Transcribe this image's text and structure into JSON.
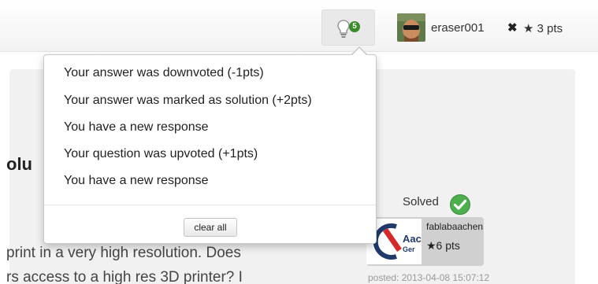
{
  "navbar": {
    "notification_count": "5",
    "username": "eraser001",
    "logout_symbol": "✖",
    "points": "★ 3 pts"
  },
  "notifications": {
    "items": [
      "Your answer was downvoted (-1pts)",
      "Your answer was marked as solution (+2pts)",
      "You have a new response",
      "Your question was upvoted (+1pts)",
      "You have a new response"
    ],
    "clear_label": "clear all"
  },
  "question": {
    "title_fragment": "olu",
    "body_line1": "print in a very high resolution. Does",
    "body_line2": "rs access to a high res 3D printer? I"
  },
  "answer": {
    "solved_label": "Solved",
    "org_logo_text1": "Aac",
    "org_logo_text2": "Ger",
    "answerer": "fablabaachen",
    "answerer_points": "★6 pts",
    "posted": "posted: 2013-04-08 15:07:12"
  },
  "colors": {
    "badge_green": "#3a8b2a",
    "solved_green": "#4cae4c"
  }
}
